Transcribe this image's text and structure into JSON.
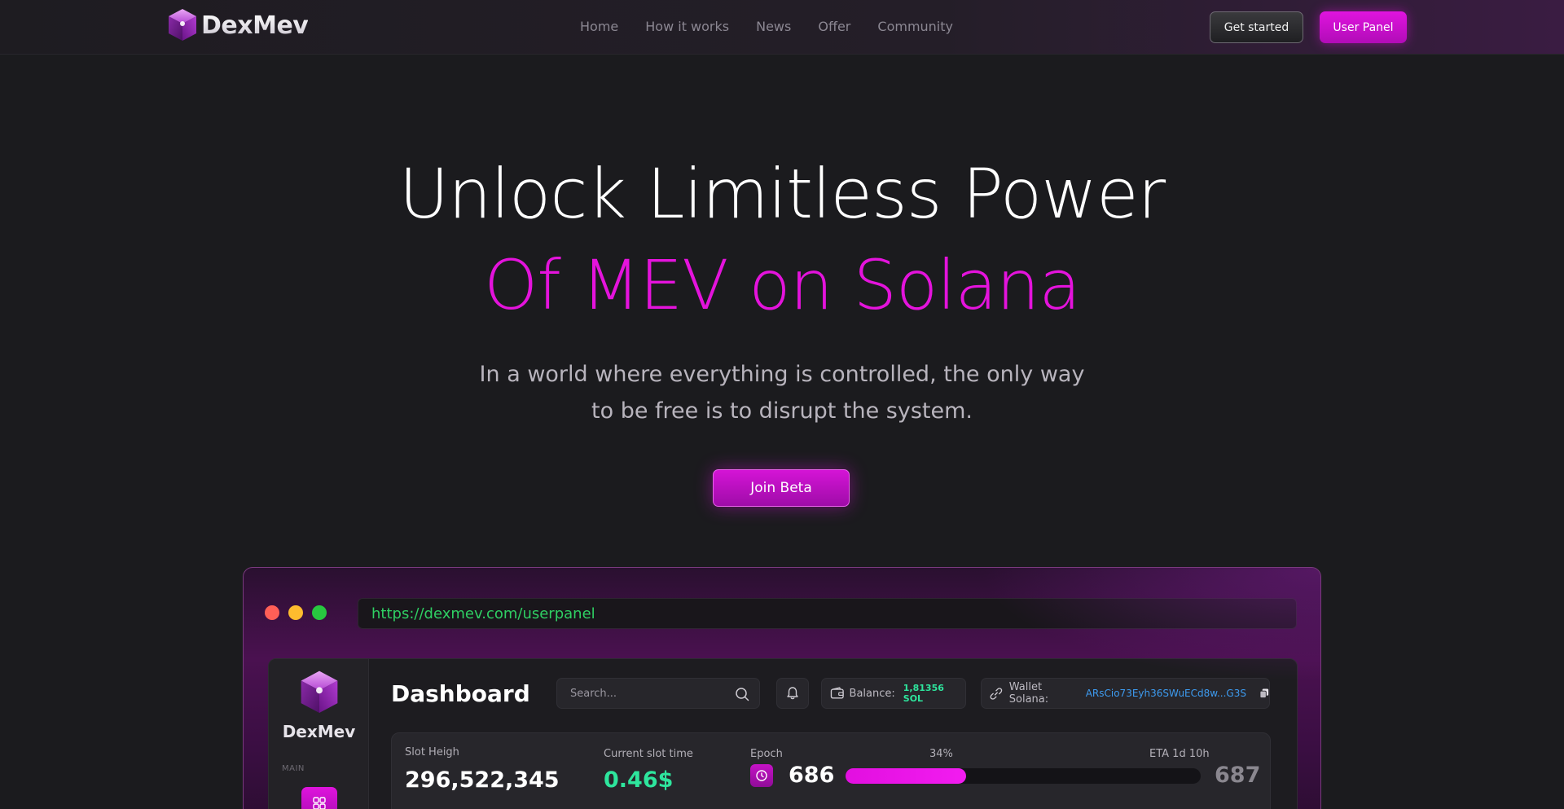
{
  "nav": {
    "brand": "DexMev",
    "links": [
      "Home",
      "How it works",
      "News",
      "Offer",
      "Community"
    ],
    "get_started": "Get started",
    "user_panel": "User Panel"
  },
  "hero": {
    "line1": "Unlock Limitless Power",
    "line2": "Of MEV on Solana",
    "sub_line1": "In a world where everything is controlled, the only way",
    "sub_line2": "to be free is to disrupt the system.",
    "cta": "Join Beta"
  },
  "mockup": {
    "url": "https://dexmev.com/userpanel",
    "sidebar": {
      "brand": "DexMev",
      "section_main": "MAIN"
    },
    "title": "Dashboard",
    "search_placeholder": "Search...",
    "balance_label": "Balance:",
    "balance_value": "1,81356 SOL",
    "wallet_label": "Wallet Solana:",
    "wallet_address": "ARsCio73Eyh36SWuECd8w...G3S",
    "stats": {
      "slot_height_label": "Slot Heigh",
      "slot_height_value": "296,522,345",
      "slot_time_label": "Current slot time",
      "slot_time_value": "0.46$",
      "epoch_label": "Epoch",
      "epoch_current": "686",
      "epoch_next": "687",
      "progress_label": "34%",
      "progress_fraction": 0.34,
      "eta_label": "ETA 1d 10h"
    }
  },
  "colors": {
    "accent": "#e413dc",
    "background": "#1b1b1e",
    "url_green": "#2fcf63",
    "balance_green": "#2ee59d",
    "slot_time_green": "#2ee59d",
    "wallet_blue": "#3d9bf0"
  },
  "icons": {
    "brand": "cube-logo-icon",
    "search": "search-icon",
    "bell": "bell-icon",
    "wallet": "wallet-icon",
    "link": "link-icon",
    "copy": "copy-icon",
    "epoch": "clock-icon",
    "dashboard": "grid-icon"
  }
}
